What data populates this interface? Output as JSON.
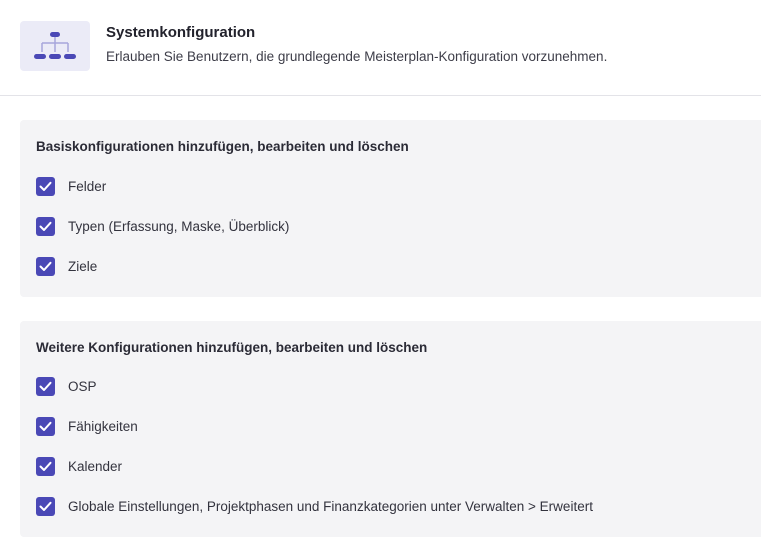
{
  "header": {
    "icon": "hierarchy-icon",
    "title": "Systemkonfiguration",
    "subtitle": "Erlauben Sie Benutzern, die grundlegende Meisterplan-Konfiguration vorzunehmen."
  },
  "sections": [
    {
      "title": "Basiskonfigurationen hinzufügen, bearbeiten und löschen",
      "items": [
        {
          "label": "Felder",
          "checked": true
        },
        {
          "label": "Typen (Erfassung, Maske, Überblick)",
          "checked": true
        },
        {
          "label": "Ziele",
          "checked": true
        }
      ]
    },
    {
      "title": "Weitere Konfigurationen hinzufügen, bearbeiten und löschen",
      "items": [
        {
          "label": "OSP",
          "checked": true
        },
        {
          "label": "Fähigkeiten",
          "checked": true
        },
        {
          "label": "Kalender",
          "checked": true
        },
        {
          "label": "Globale Einstellungen, Projektphasen und Finanzkategorien unter Verwalten > Erweitert",
          "checked": true
        }
      ]
    }
  ],
  "colors": {
    "accent": "#4a48b6",
    "icon_bg": "#ebebf7",
    "panel_bg": "#f4f4f6"
  }
}
